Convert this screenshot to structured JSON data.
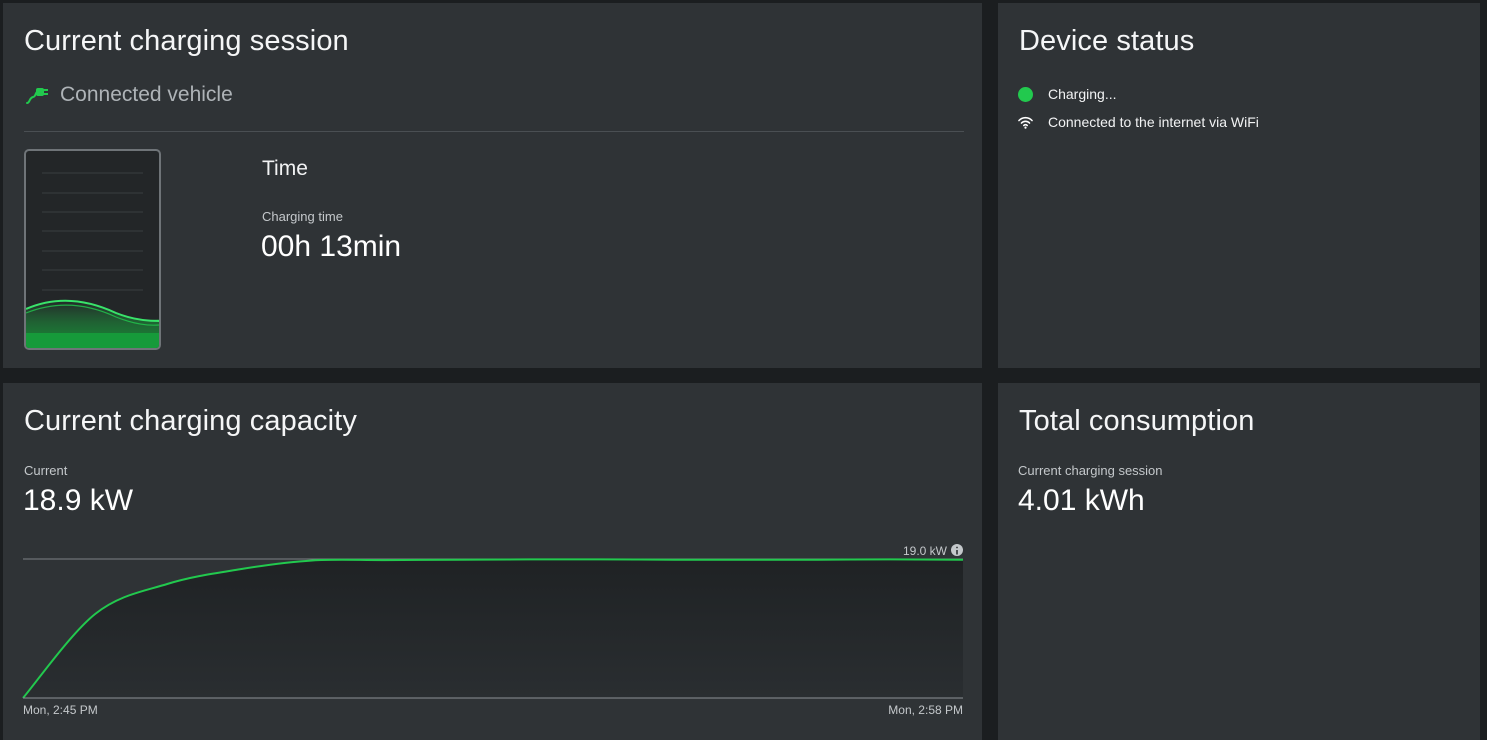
{
  "session": {
    "title": "Current charging session",
    "vehicle_icon": "plug-icon",
    "vehicle_label": "Connected vehicle",
    "time_title": "Time",
    "charging_time_label": "Charging time",
    "charging_time_value": "00h 13min",
    "accent": "#22c94e"
  },
  "status": {
    "title": "Device status",
    "items": [
      {
        "icon": "status-dot-icon",
        "label": "Charging...",
        "color": "#22c94e"
      },
      {
        "icon": "wifi-icon",
        "label": "Connected to the internet via WiFi"
      }
    ]
  },
  "capacity": {
    "title": "Current charging capacity",
    "current_label": "Current",
    "current_value": "18.9 kW",
    "max_label": "19.0 kW",
    "info_icon": "info-icon"
  },
  "total": {
    "title": "Total consumption",
    "session_label": "Current charging session",
    "session_value": "4.01 kWh"
  },
  "chart_data": {
    "type": "area",
    "x_start_label": "Mon, 2:45 PM",
    "x_end_label": "Mon, 2:58 PM",
    "ylim": [
      0,
      19.0
    ],
    "reference_line": 19.0,
    "x_minutes": [
      0,
      1,
      2,
      3,
      4,
      5,
      6,
      7,
      8,
      9,
      10,
      11,
      12,
      13
    ],
    "values": [
      0,
      11.5,
      15.6,
      17.6,
      18.8,
      18.85,
      18.9,
      18.95,
      18.95,
      18.9,
      18.9,
      18.9,
      18.95,
      18.9
    ],
    "line_color": "#22c94e"
  }
}
